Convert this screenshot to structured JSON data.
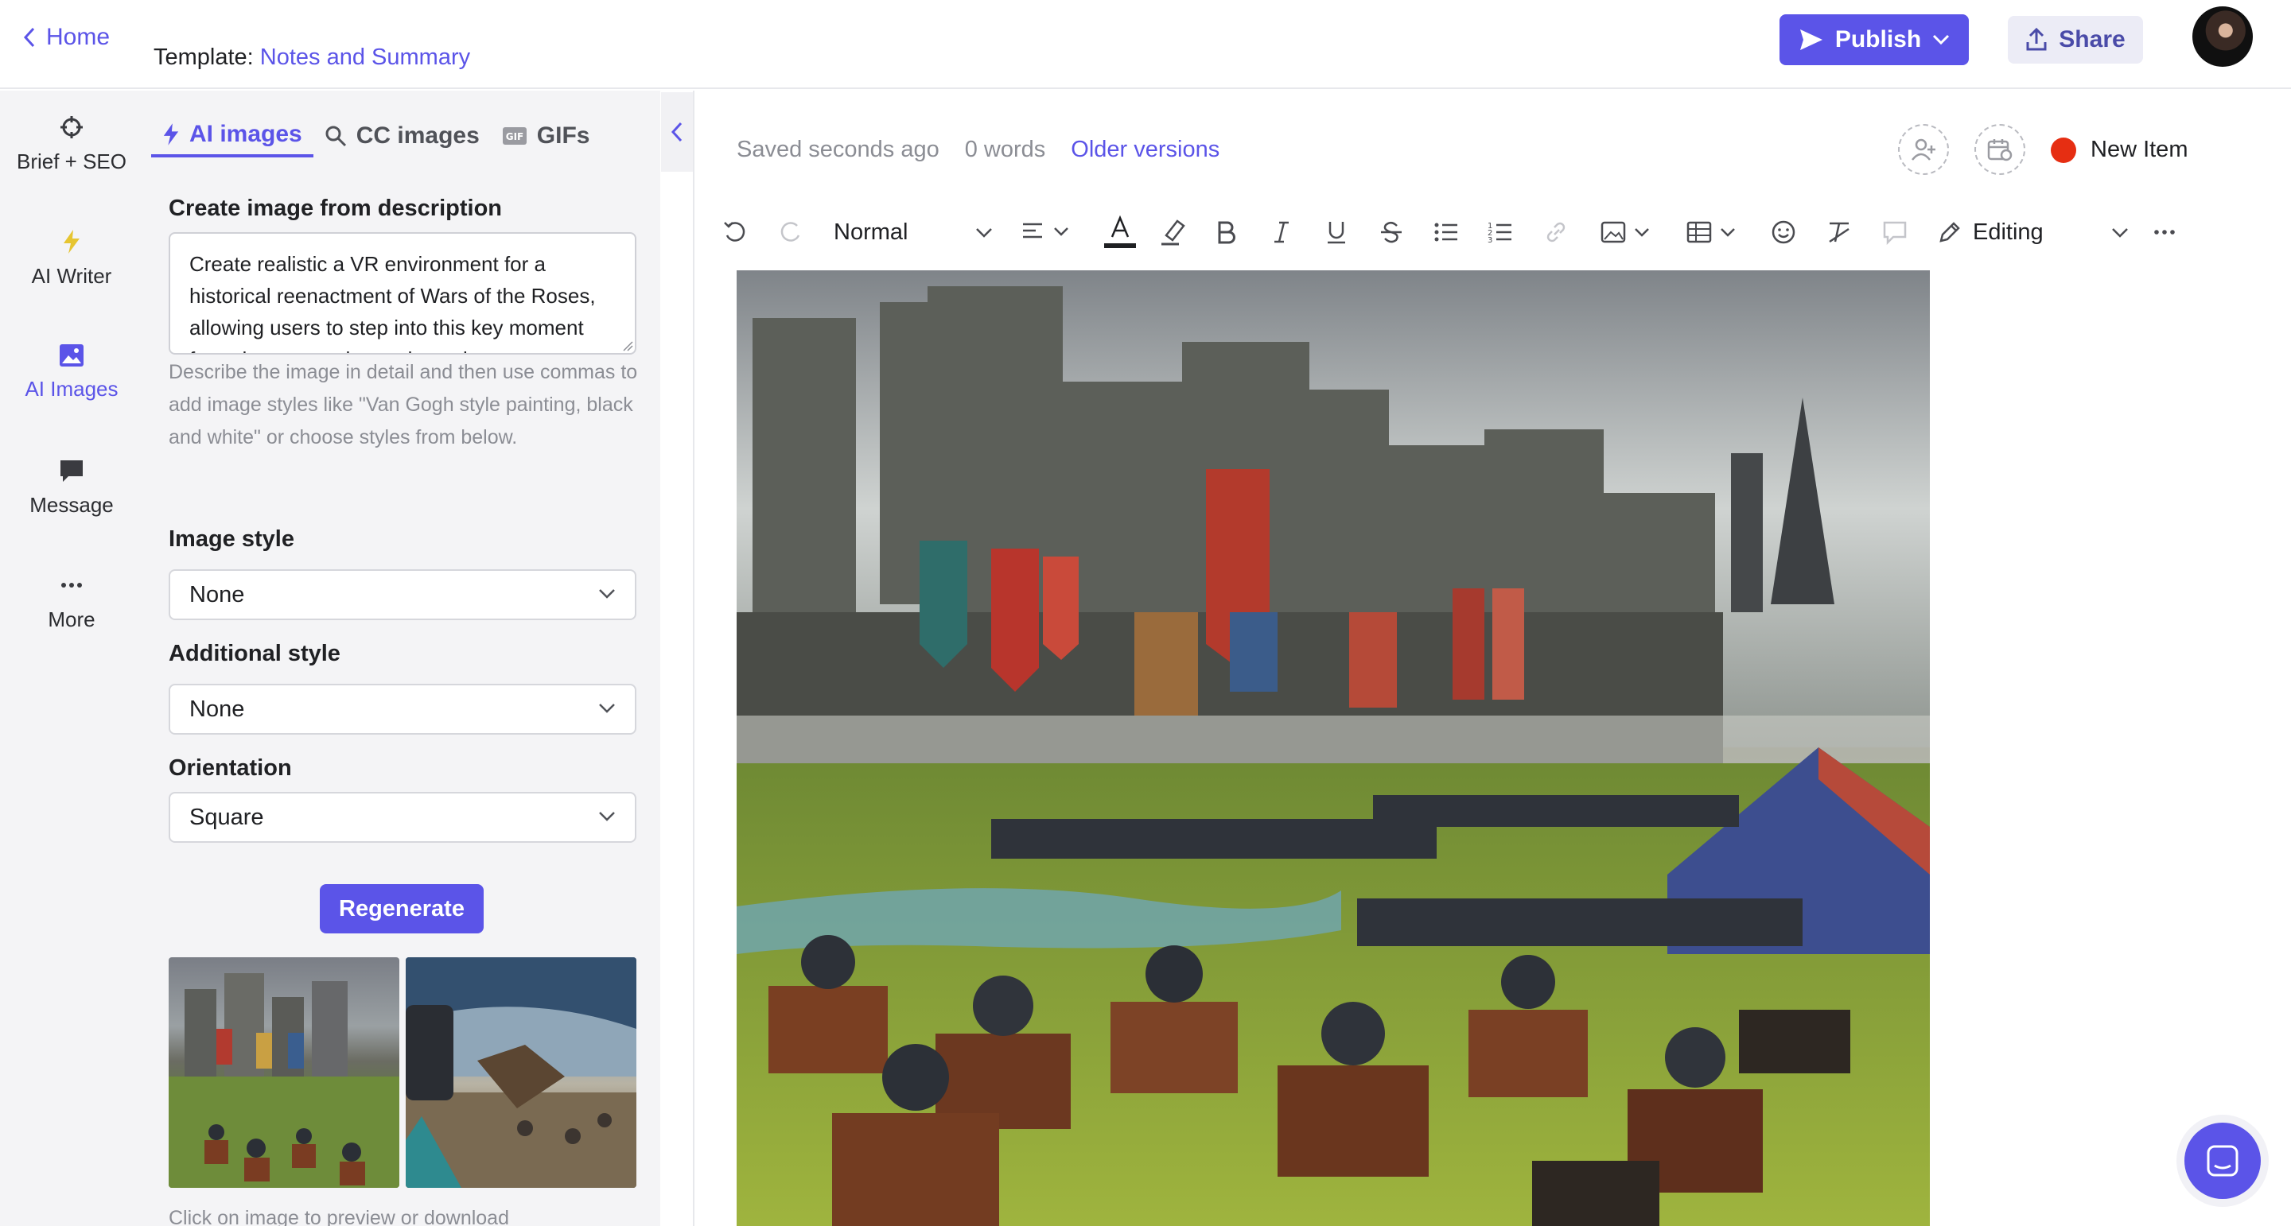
{
  "header": {
    "home_label": "Home",
    "template_prefix": "Template:",
    "template_name": "Notes and Summary",
    "publish_label": "Publish",
    "share_label": "Share"
  },
  "rail": {
    "items": [
      {
        "label": "Brief + SEO",
        "icon": "crosshair-icon"
      },
      {
        "label": "AI Writer",
        "icon": "lightning-icon"
      },
      {
        "label": "AI Images",
        "icon": "image-icon"
      },
      {
        "label": "Message",
        "icon": "chat-icon"
      },
      {
        "label": "More",
        "icon": "ellipsis-icon"
      }
    ]
  },
  "panel": {
    "tabs": [
      {
        "label": "AI images",
        "icon": "lightning-icon"
      },
      {
        "label": "CC images",
        "icon": "search-icon"
      },
      {
        "label": "GIFs",
        "icon": "gif-icon"
      }
    ],
    "description_label": "Create image from description",
    "description_value": "Create realistic a VR environment for a historical reenactment of Wars of the Roses, allowing users to step into this key moment from the past and experience it",
    "hint": "Describe the image in detail and then use commas to add image styles like \"Van Gogh style painting, black and white\" or choose styles from below.",
    "image_style_label": "Image style",
    "image_style_value": "None",
    "additional_style_label": "Additional style",
    "additional_style_value": "None",
    "orientation_label": "Orientation",
    "orientation_value": "Square",
    "regenerate_label": "Regenerate",
    "bottom_hint": "Click on image to preview or download"
  },
  "editor": {
    "saved_status": "Saved seconds ago",
    "word_count": "0 words",
    "older_versions": "Older versions",
    "new_item_label": "New Item",
    "block_style": "Normal",
    "mode": "Editing",
    "accent_color": "#5b54e8",
    "status_dot_color": "#e62e12"
  }
}
